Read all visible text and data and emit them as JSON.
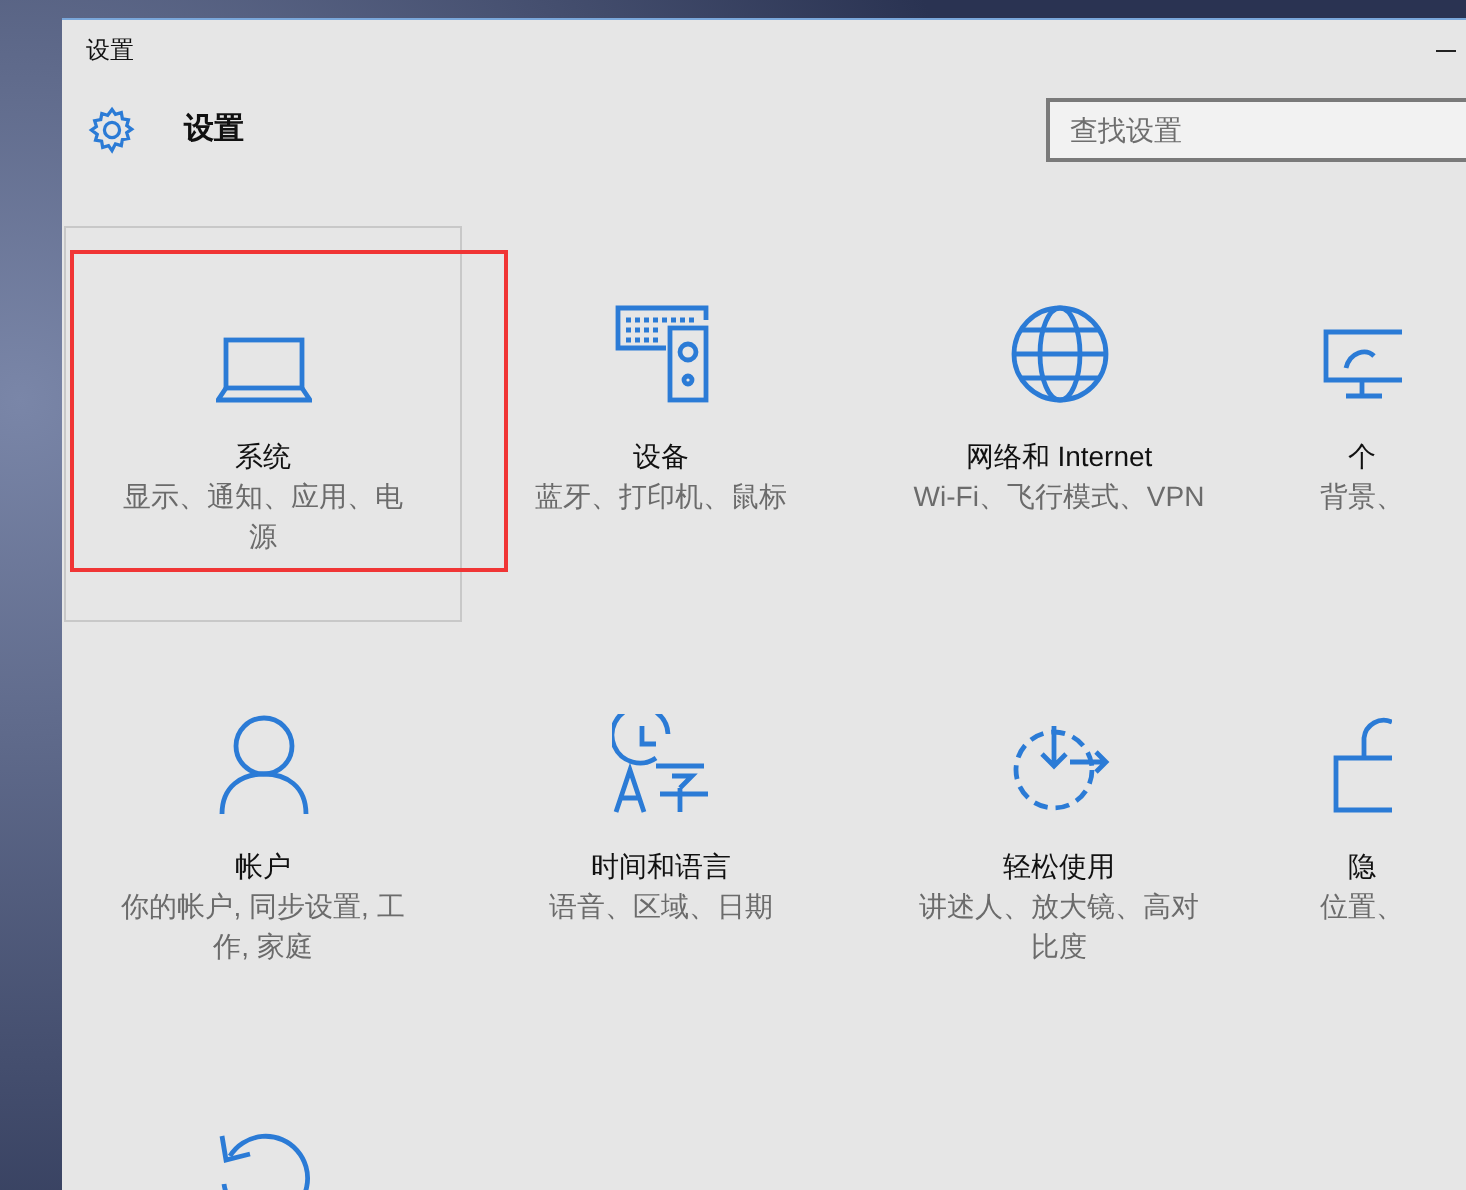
{
  "window": {
    "title": "设置"
  },
  "header": {
    "title": "设置"
  },
  "search": {
    "placeholder": "查找设置"
  },
  "tiles": [
    {
      "kind": "system",
      "title": "系统",
      "subtitle": "显示、通知、应用、电源",
      "hovered": true,
      "highlighted": true
    },
    {
      "kind": "devices",
      "title": "设备",
      "subtitle": "蓝牙、打印机、鼠标",
      "hovered": false,
      "highlighted": false
    },
    {
      "kind": "network",
      "title": "网络和 Internet",
      "subtitle": "Wi-Fi、飞行模式、VPN",
      "hovered": false,
      "highlighted": false
    },
    {
      "kind": "personalization",
      "title": "个",
      "subtitle": "背景、",
      "hovered": false,
      "highlighted": false
    },
    {
      "kind": "accounts",
      "title": "帐户",
      "subtitle": "你的帐户, 同步设置, 工作, 家庭",
      "hovered": false,
      "highlighted": false
    },
    {
      "kind": "time",
      "title": "时间和语言",
      "subtitle": "语音、区域、日期",
      "hovered": false,
      "highlighted": false
    },
    {
      "kind": "ease",
      "title": "轻松使用",
      "subtitle": "讲述人、放大镜、高对比度",
      "hovered": false,
      "highlighted": false
    },
    {
      "kind": "privacy",
      "title": "隐",
      "subtitle": "位置、",
      "hovered": false,
      "highlighted": false
    },
    {
      "kind": "update",
      "hovered": false,
      "highlighted": false
    }
  ]
}
